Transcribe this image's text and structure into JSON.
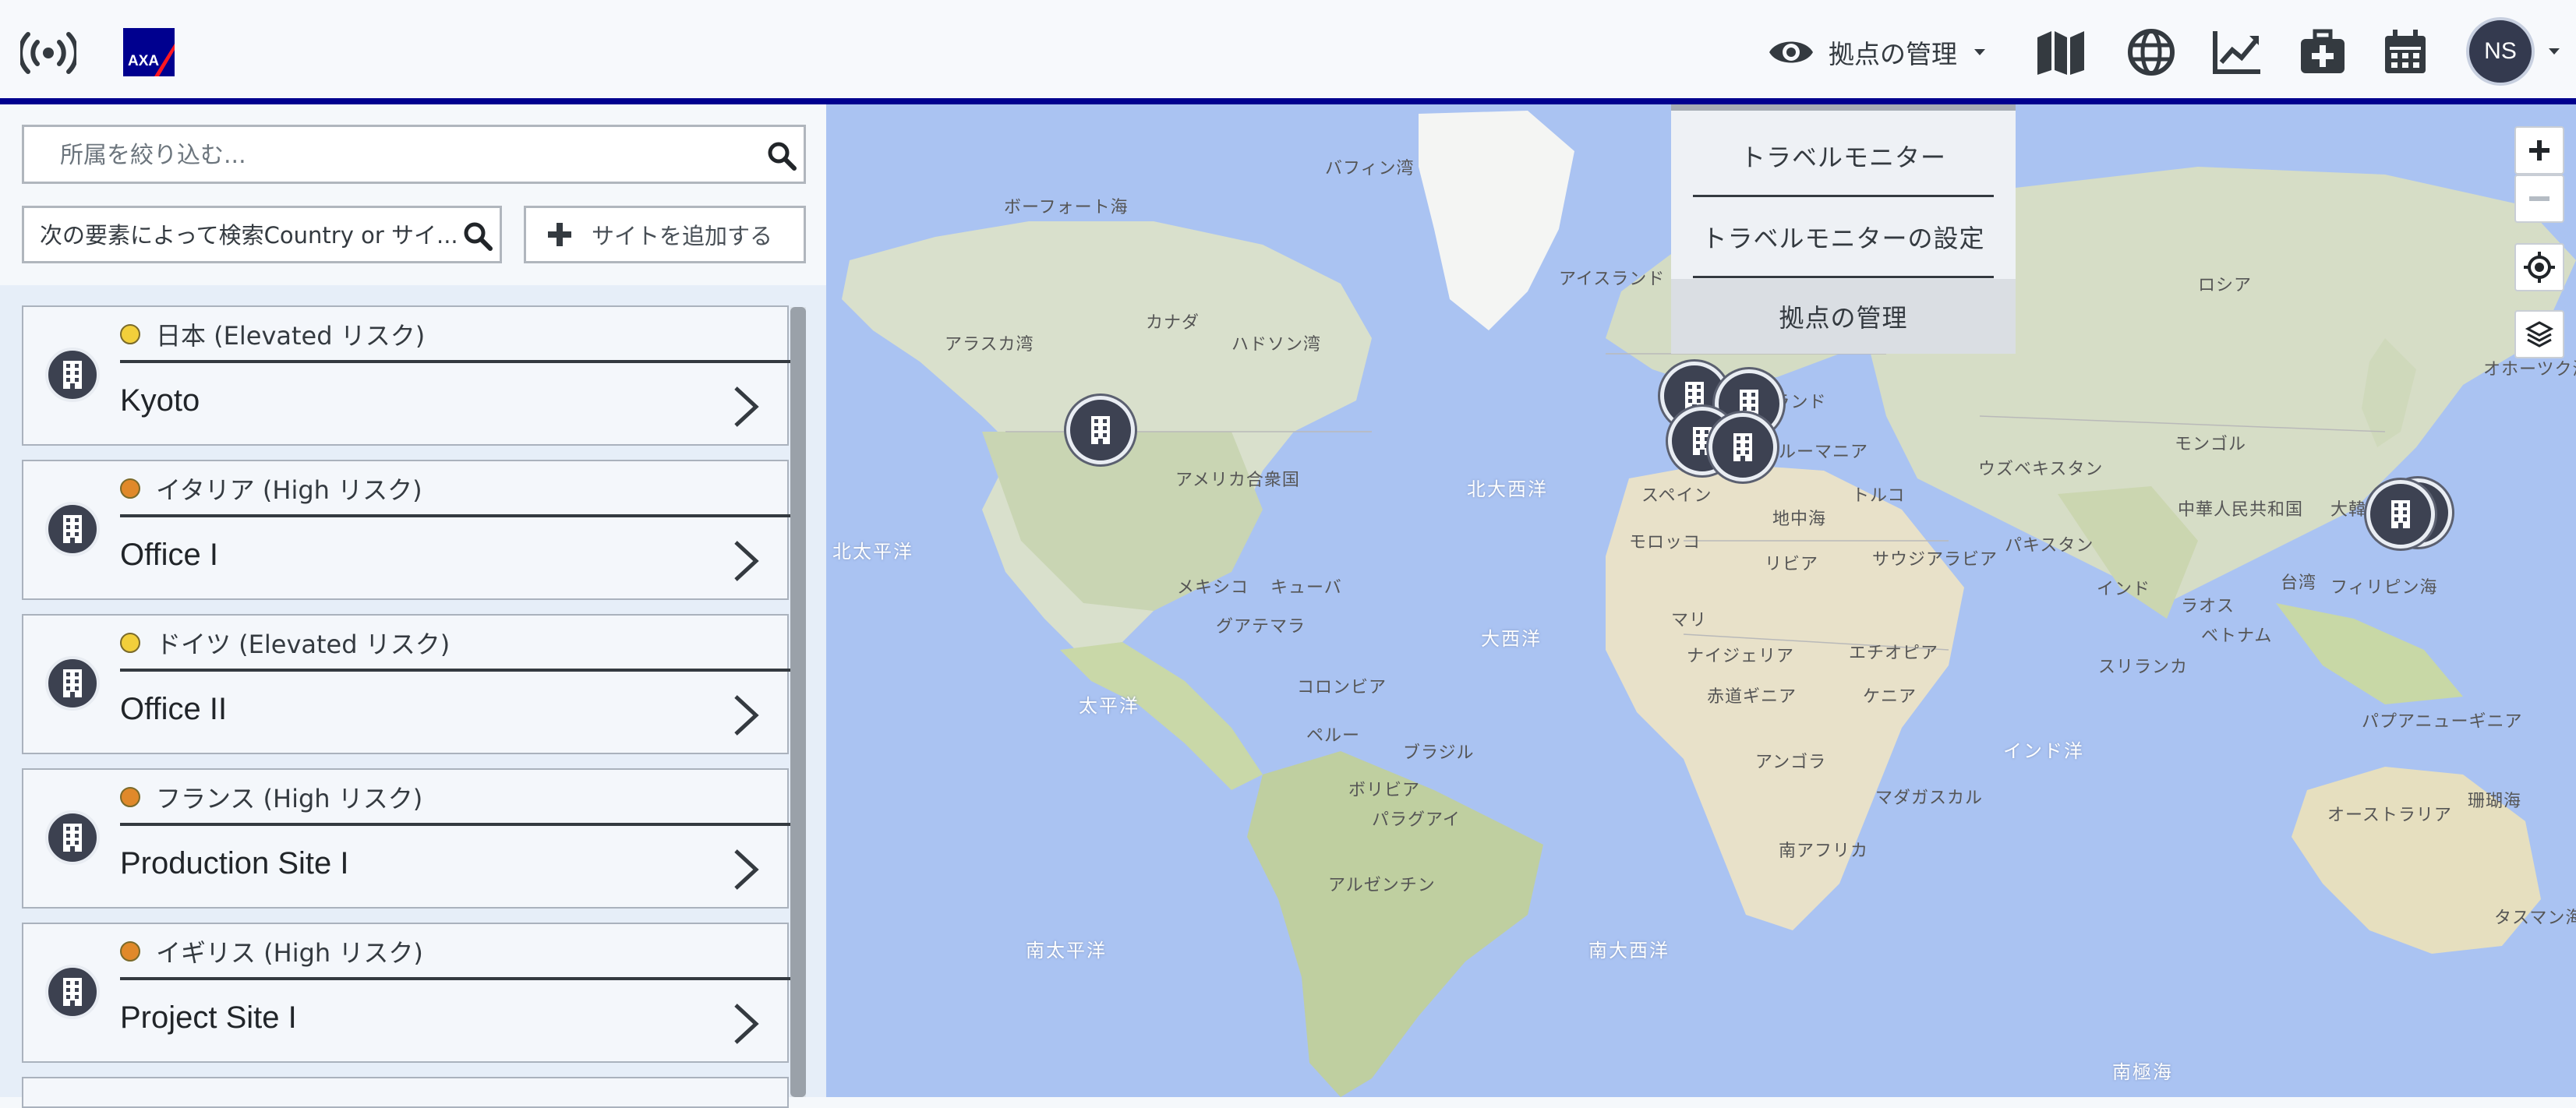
{
  "topbar": {
    "view_label": "拠点の管理",
    "avatar_initials": "NS",
    "brand_color": "#00008f",
    "nav_icons": [
      "map-icon",
      "globe-icon",
      "chart-line-icon",
      "medical-kit-icon",
      "calendar-icon"
    ]
  },
  "dropdown": {
    "items": [
      "トラベルモニター",
      "トラベルモニターの設定",
      "拠点の管理"
    ],
    "active_index": 2
  },
  "sidebar": {
    "filter_placeholder": "所属を絞り込む...",
    "search_placeholder": "次の要素によって検索Country or サイ...",
    "add_site_label": "サイトを追加する",
    "sites": [
      {
        "risk": "日本 (Elevated リスク)",
        "level": "Elevated",
        "color": "#f2cf3b",
        "name": "Kyoto"
      },
      {
        "risk": "イタリア (High リスク)",
        "level": "High",
        "color": "#e0892a",
        "name": "Office I"
      },
      {
        "risk": "ドイツ (Elevated リスク)",
        "level": "Elevated",
        "color": "#f2cf3b",
        "name": "Office II"
      },
      {
        "risk": "フランス (High リスク)",
        "level": "High",
        "color": "#e0892a",
        "name": "Production Site I"
      },
      {
        "risk": "イギリス (High リスク)",
        "level": "High",
        "color": "#e0892a",
        "name": "Project Site I"
      }
    ]
  },
  "map": {
    "labels": [
      "ボーフォート海",
      "バフィン湾",
      "アイスランド",
      "カナダ",
      "ハドソン湾",
      "アラスカ湾",
      "アメリカ合衆国",
      "北大西洋",
      "北太平洋",
      "メキシコ",
      "キューバ",
      "グアテマラ",
      "コロンビア",
      "ペルー",
      "ブラジル",
      "ボリビア",
      "パラグアイ",
      "アルゼンチン",
      "大西洋",
      "太平洋",
      "南太平洋",
      "南大西洋",
      "モロッコ",
      "リビア",
      "マリ",
      "ナイジェリア",
      "赤道ギニア",
      "エチオピア",
      "ケニア",
      "アンゴラ",
      "南アフリカ",
      "マダガスカル",
      "サウジアラビア",
      "トルコ",
      "ウズベキスタン",
      "パキスタン",
      "インド",
      "スリランカ",
      "ラオス",
      "ベトナム",
      "中華人民共和国",
      "モンゴル",
      "ロシア",
      "オホーツク海",
      "フィリピン海",
      "パプアニューギニア",
      "オーストラリア",
      "珊瑚海",
      "タスマン海",
      "インド洋",
      "南極海",
      "スペイン",
      "フィンランド",
      "ルーマニア",
      "地中海",
      "台湾",
      "大韓"
    ],
    "pin_count": 6
  }
}
